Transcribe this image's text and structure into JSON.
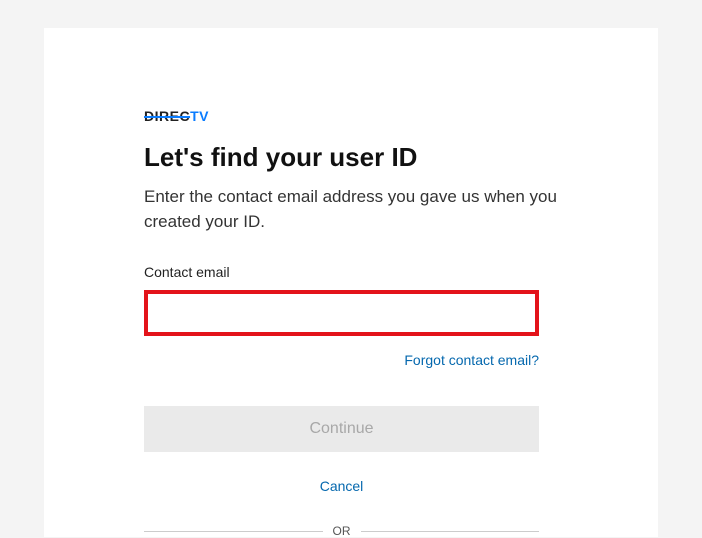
{
  "logo": {
    "part1": "DIREC",
    "part2": "TV"
  },
  "heading": "Let's find your user ID",
  "subheading": "Enter the contact email address you gave us when you created your ID.",
  "form": {
    "field_label": "Contact email",
    "email_value": "",
    "forgot_link": "Forgot contact email?",
    "continue_label": "Continue",
    "cancel_label": "Cancel"
  },
  "divider_text": "OR"
}
